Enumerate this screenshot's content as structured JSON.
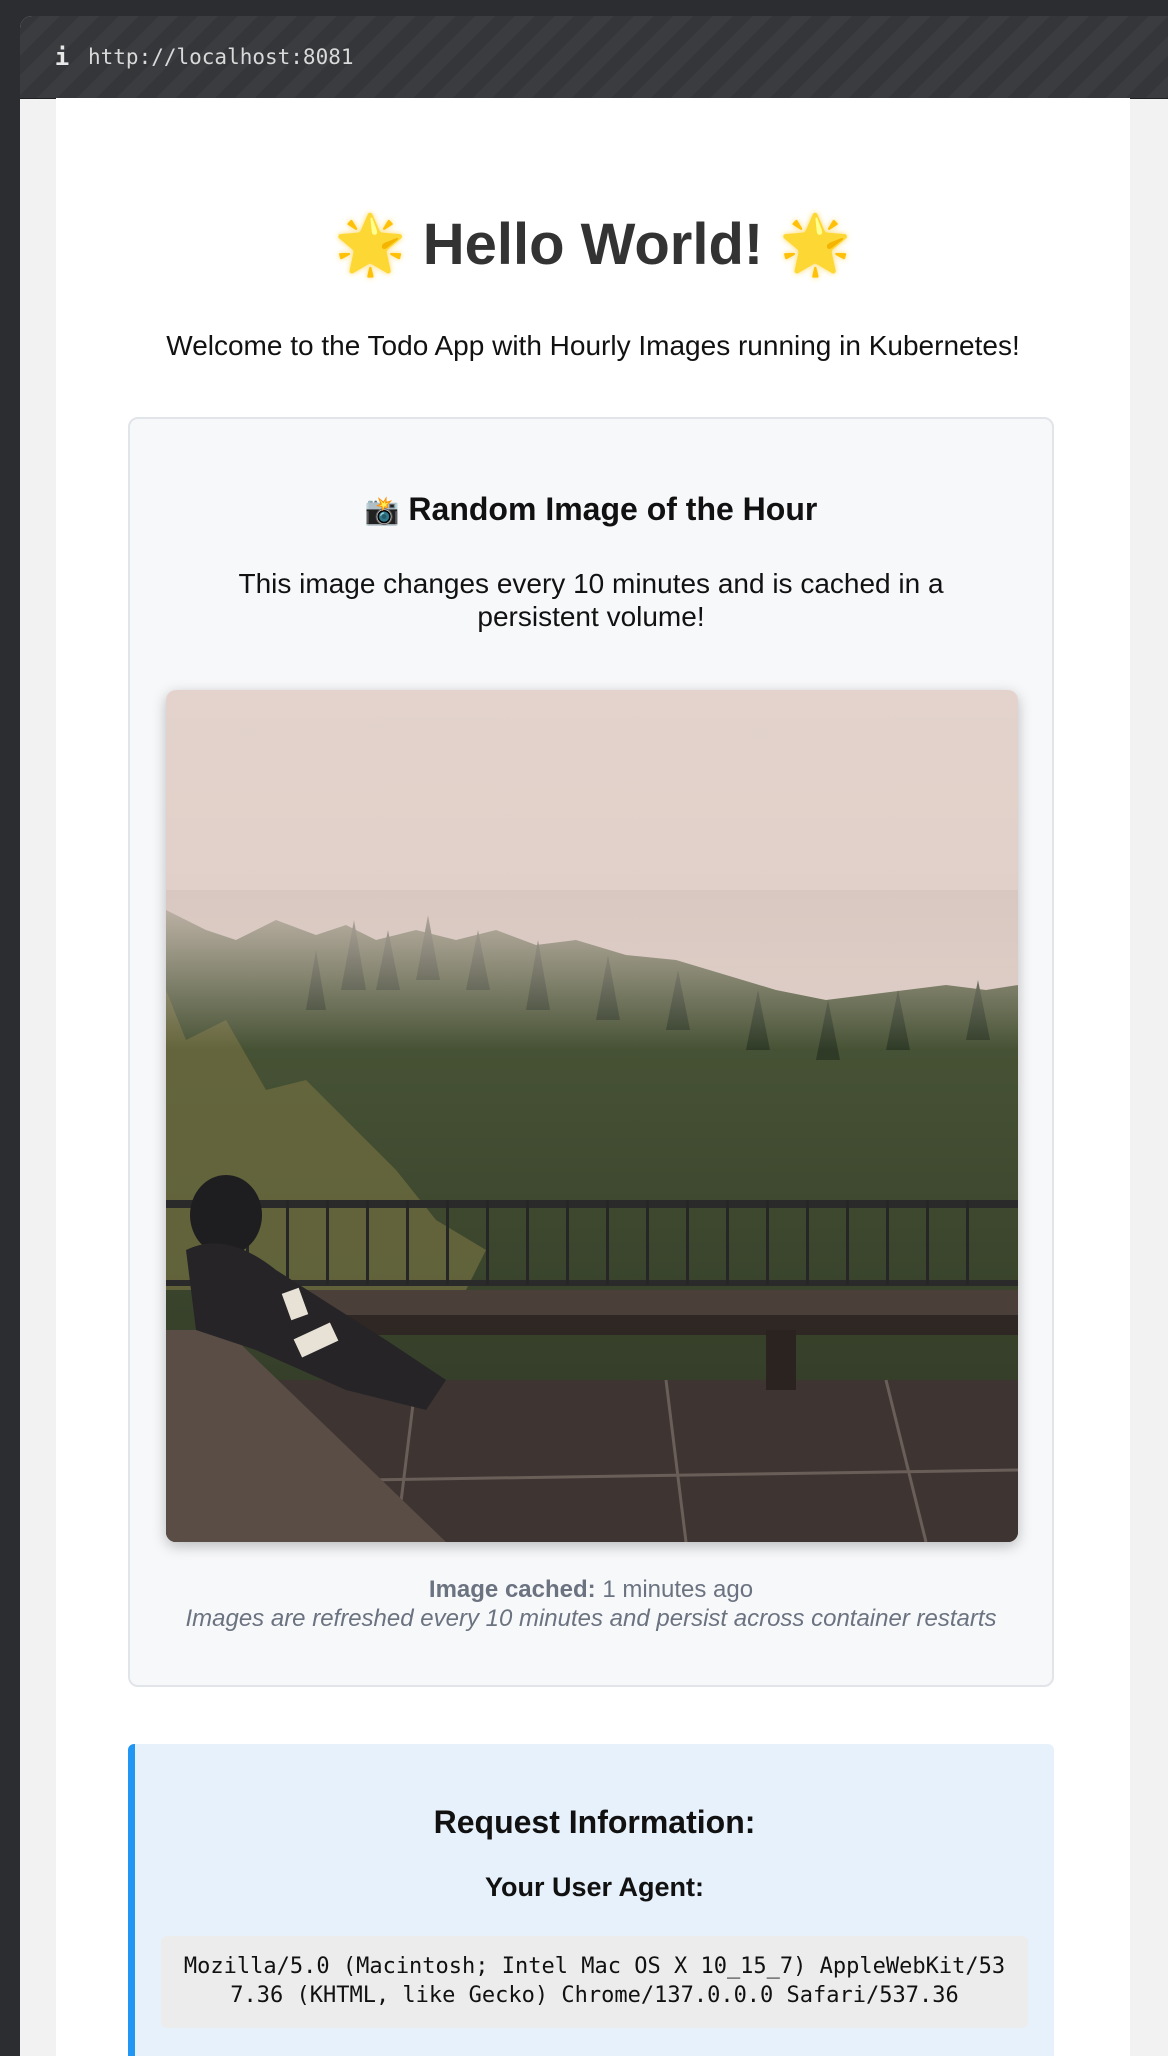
{
  "browser": {
    "url": "http://localhost:8081",
    "info_icon": "info-icon"
  },
  "header": {
    "title": "Hello World!",
    "star_icon": "🌟",
    "subtitle": "Welcome to the Todo App with Hourly Images running in Kubernetes!"
  },
  "image_section": {
    "camera_icon": "📸",
    "title": "Random Image of the Hour",
    "description": "This image changes every 10 minutes and is cached in a persistent volume!",
    "photo_alt": "Foggy forest hillside with wooden railing and bench",
    "cached_label": "Image cached:",
    "cached_value": "1 minutes ago",
    "note": "Images are refreshed every 10 minutes and persist across container restarts"
  },
  "request_info": {
    "title": "Request Information:",
    "user_agent_label": "Your User Agent:",
    "user_agent": "Mozilla/5.0 (Macintosh; Intel Mac OS X 10_15_7) AppleWebKit/537.36 (KHTML, like Gecko) Chrome/137.0.0.0 Safari/537.36"
  },
  "colors": {
    "accent": "#2196f3",
    "request_bg": "#e6f1fb",
    "card_bg": "#f7f8fa",
    "muted_text": "#6b7280"
  }
}
